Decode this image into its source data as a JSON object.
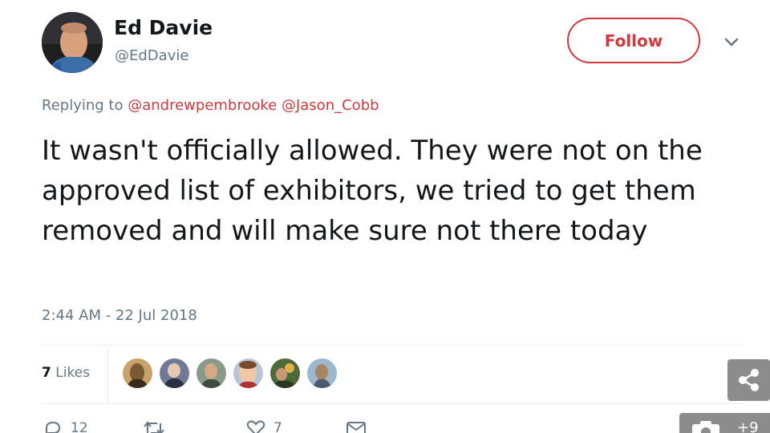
{
  "user": {
    "display_name": "Ed Davie",
    "handle": "@EdDavie",
    "follow_label": "Follow"
  },
  "reply": {
    "prefix": "Replying to",
    "mention1": "@andrewpembrooke",
    "mention2": "@Jason_Cobb"
  },
  "tweet": {
    "text": "It wasn't officially allowed. They were not on the approved list of exhibitors, we tried to get them removed and will make sure not there today",
    "timestamp": "2:44 AM - 22 Jul 2018"
  },
  "stats": {
    "likes_count": "7",
    "likes_label": "Likes",
    "replies_count": "12",
    "likes_action_count": "7"
  },
  "overlay": {
    "photo_count": "+9"
  },
  "colors": {
    "accent": "#d0393e",
    "muted": "#657786",
    "text": "#14171a"
  }
}
